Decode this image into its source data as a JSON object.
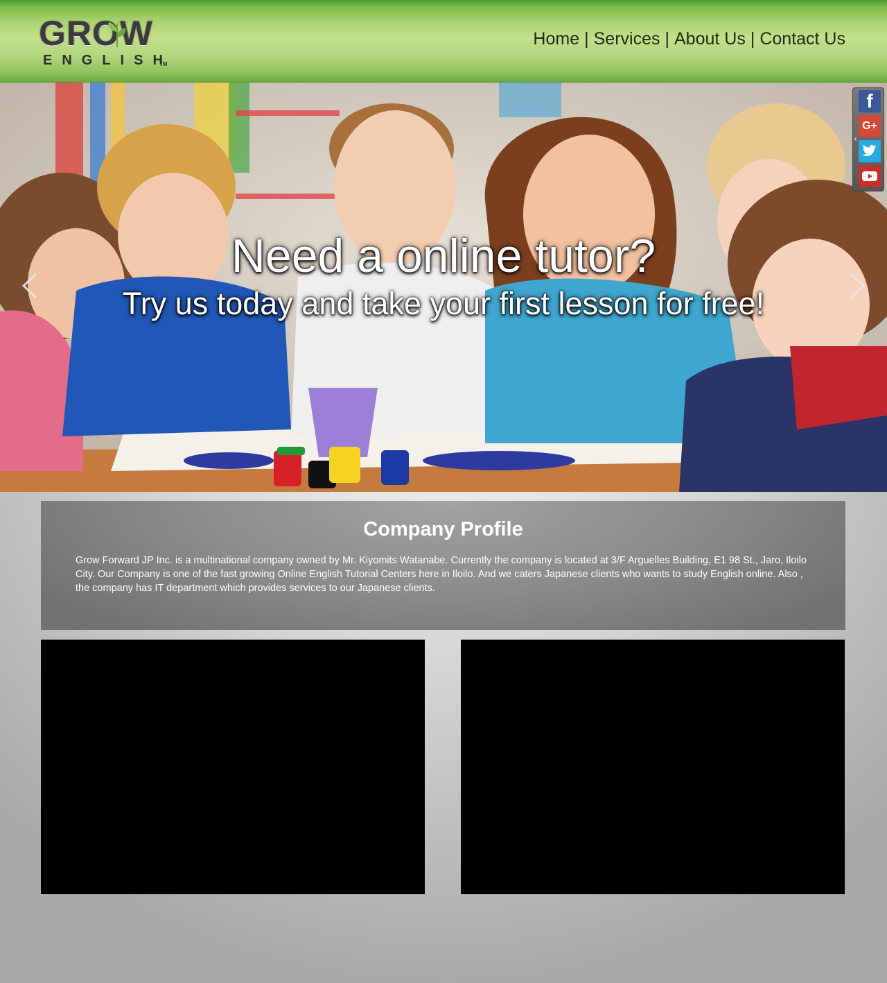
{
  "brand": {
    "logo_text": "GROW",
    "logo_subtext": "ENGLISH",
    "logo_tm": "TM"
  },
  "nav": {
    "items": [
      {
        "label": "Home"
      },
      {
        "label": "Services"
      },
      {
        "label": "About Us"
      },
      {
        "label": "Contact Us"
      }
    ],
    "separator": "|"
  },
  "hero": {
    "headline": "Need a online tutor?",
    "subheadline": "Try us today and take your first lesson for free!",
    "prev_icon": "chevron-left-icon",
    "next_icon": "chevron-right-icon"
  },
  "social": {
    "items": [
      {
        "name": "facebook-icon",
        "glyph": "f",
        "color": "#3b5998"
      },
      {
        "name": "google-plus-icon",
        "glyph": "G+",
        "color": "#d34836"
      },
      {
        "name": "twitter-icon",
        "color": "#28a9e0"
      },
      {
        "name": "youtube-icon",
        "color": "#c4302b"
      }
    ]
  },
  "profile": {
    "title": "Company Profile",
    "body": "Grow Forward JP Inc. is a multinational company owned by Mr. Kiyomits Watanabe. Currently the company is located at 3/F Arguelles Building, E1 98 St., Jaro, Iloilo City. Our Company is one of the fast growing Online English Tutorial Centers here in Iloilo. And we caters Japanese clients who wants to study English online. Also , the company has IT department which provides services to our Japanese clients."
  },
  "colors": {
    "header_green": "#a9d26e",
    "video_bg": "#000000",
    "profile_bg": "#8b8b8b",
    "text_white": "#ffffff"
  }
}
